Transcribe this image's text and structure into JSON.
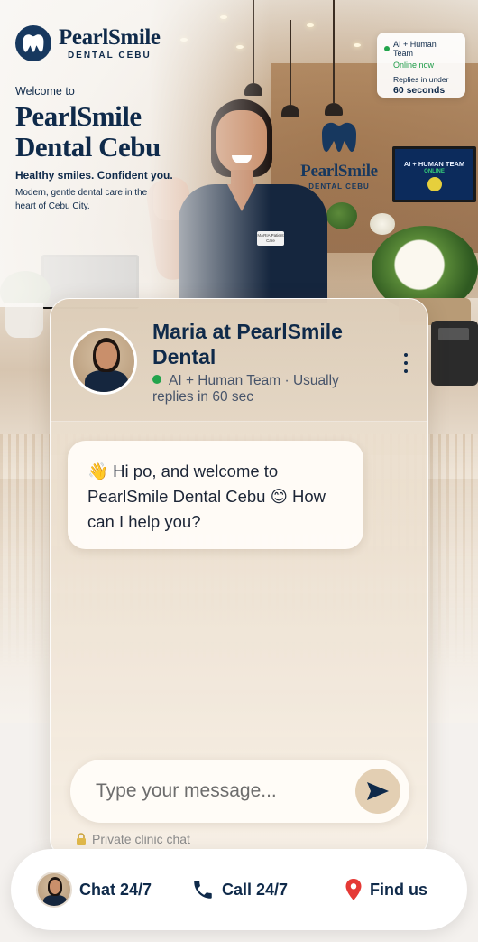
{
  "brand": {
    "name": "PearlSmile",
    "subtitle": "DENTAL CEBU"
  },
  "hero": {
    "welcome_small": "Welcome to",
    "welcome_big": "PearlSmile Dental Cebu",
    "tagline": "Healthy smiles. Confident you.",
    "subtagline": "Modern, gentle dental care in the heart of Cebu City.",
    "wall_logo_name": "PearlSmile",
    "wall_logo_sub": "DENTAL CEBU",
    "tv_line1": "AI + HUMAN TEAM",
    "tv_line2": "ONLINE",
    "name_badge": "MARIA Patient Care"
  },
  "status_card": {
    "team": "AI + Human Team",
    "online": "Online now",
    "replies_label": "Replies in under",
    "replies_time": "60 seconds"
  },
  "chat": {
    "agent_name": "Maria at PearlSmile Dental",
    "status_text": "AI + Human Team · Usually replies in 60 sec",
    "greeting": "👋 Hi po, and welcome to PearlSmile Dental Cebu 😊 How can I help you?",
    "input_placeholder": "Type your message...",
    "private_note": "Private clinic chat"
  },
  "bottom_nav": {
    "chat_label": "Chat 24/7",
    "call_label": "Call 24/7",
    "find_label": "Find us"
  },
  "icons": {
    "brand": "tooth-icon",
    "menu": "more-vertical-icon",
    "send": "send-icon",
    "lock": "lock-icon",
    "call": "phone-icon",
    "find": "map-pin-icon"
  },
  "colors": {
    "brand_navy": "#0f2a4a",
    "online_green": "#22a44c",
    "send_button": "#e3cfb3",
    "map_pin": "#e53935"
  }
}
